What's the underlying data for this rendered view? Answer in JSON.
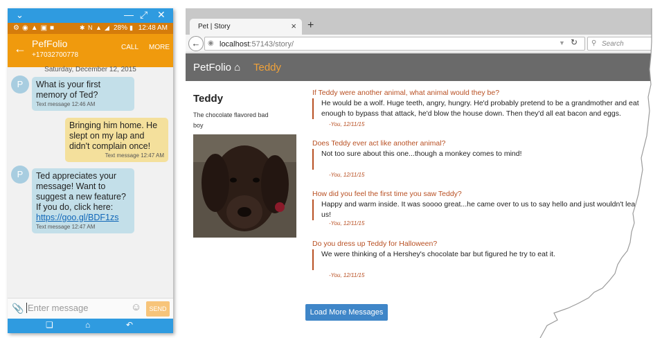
{
  "phone": {
    "status": {
      "battery": "28%",
      "time": "12:48 AM"
    },
    "contact": {
      "name": "PefFolio",
      "number": "+17032700778",
      "call_label": "CALL",
      "more_label": "MORE"
    },
    "date_header": "Saturday, December 12, 2015",
    "messages": [
      {
        "direction": "in",
        "avatar": "P",
        "text": "What is your first memory of Ted?",
        "timestamp": "Text message 12:46 AM"
      },
      {
        "direction": "out",
        "text": "Bringing him home.  He slept on my lap and didn't complain once!",
        "timestamp": "Text message 12:47 AM"
      },
      {
        "direction": "in",
        "avatar": "P",
        "text": "Ted appreciates your message! Want to suggest a new feature? If you do, click here:",
        "link": "https://goo.gl/BDF1zs",
        "timestamp": "Text message 12:47 AM"
      }
    ],
    "composer": {
      "placeholder": "Enter message",
      "send_label": "SEND"
    },
    "icons": [
      "chevron-down-icon",
      "minimize-icon",
      "expand-icon",
      "close-icon",
      "back-arrow-icon",
      "attach-icon",
      "emoji-icon",
      "recent-apps-icon",
      "home-icon",
      "back-icon"
    ]
  },
  "browser": {
    "tab_title": "Pet | Story",
    "url_host": "localhost",
    "url_rest": ":57143/story/",
    "search_placeholder": "Search",
    "navbar": {
      "brand": "PetFolio",
      "pet_link": "Teddy"
    },
    "pet": {
      "name": "Teddy",
      "description": "The chocolate flavored bad boy"
    },
    "stories": [
      {
        "question": "If Teddy were another animal, what animal would they be?",
        "answer_lines": [
          "He would be a wolf.  Huge teeth, angry, hungry.  He'd probably pretend to be a grandmother and eat",
          "enough to bypass that attack, he'd blow the house down. Then they'd all eat bacon and eggs."
        ],
        "attribution": "-You, 12/11/15"
      },
      {
        "question": "Does Teddy ever act like another animal?",
        "answer_lines": [
          "Not too sure about this one...though a monkey comes to mind!"
        ],
        "attribution": "-You, 12/11/15"
      },
      {
        "question": "How did you feel the first time you saw Teddy?",
        "answer_lines": [
          "Happy and warm inside.  It was soooo great...he came over to us to say hello and just wouldn't lea",
          "us!"
        ],
        "attribution": "-You, 12/11/15"
      },
      {
        "question": "Do you dress up Teddy for Halloween?",
        "answer_lines": [
          "We were thinking of a Hershey's chocolate bar but figured he try to eat it."
        ],
        "attribution": "-You, 12/11/15"
      }
    ],
    "load_more_label": "Load More Messages",
    "colors": {
      "accent": "#b84f22",
      "navbar": "#6a6a6a",
      "button": "#3f86c8",
      "pet_link": "#f0a23a"
    }
  }
}
